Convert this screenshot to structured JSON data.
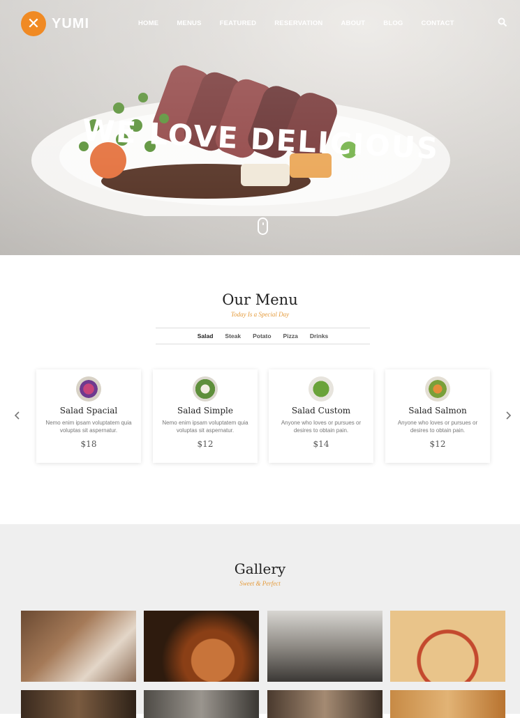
{
  "brand": {
    "name": "YUMI",
    "logo_glyph": "✕"
  },
  "nav": {
    "items": [
      "HOME",
      "MENUS",
      "FEATURED",
      "RESERVATION",
      "ABOUT",
      "BLOG",
      "CONTACT"
    ]
  },
  "hero": {
    "title": "WE LOVE DELICIOUS"
  },
  "menu_section": {
    "title": "Our Menu",
    "subtitle": "Today Is a Special Day",
    "tabs": [
      "Salad",
      "Steak",
      "Potato",
      "Pizza",
      "Drinks"
    ],
    "active_tab": "Salad",
    "cards": [
      {
        "name": "Salad Spacial",
        "desc": "Nemo enim ipsam voluptatem quia voluptas sit aspernatur.",
        "price": "$18"
      },
      {
        "name": "Salad Simple",
        "desc": "Nemo enim ipsam voluptatem quia voluptas sit aspernatur.",
        "price": "$12"
      },
      {
        "name": "Salad Custom",
        "desc": "Anyone who loves or pursues or desires to obtain pain.",
        "price": "$14"
      },
      {
        "name": "Salad Salmon",
        "desc": "Anyone who loves or pursues or desires to obtain pain.",
        "price": "$12"
      }
    ]
  },
  "gallery": {
    "title": "Gallery",
    "subtitle": "Sweet & Perfect"
  },
  "colors": {
    "accent": "#f08a24",
    "subtitle": "#e49a3a",
    "gallery_bg": "#efefef"
  },
  "icons": {
    "search": "search-icon",
    "prev": "chevron-left-icon",
    "next": "chevron-right-icon",
    "scroll": "mouse-scroll-icon"
  }
}
